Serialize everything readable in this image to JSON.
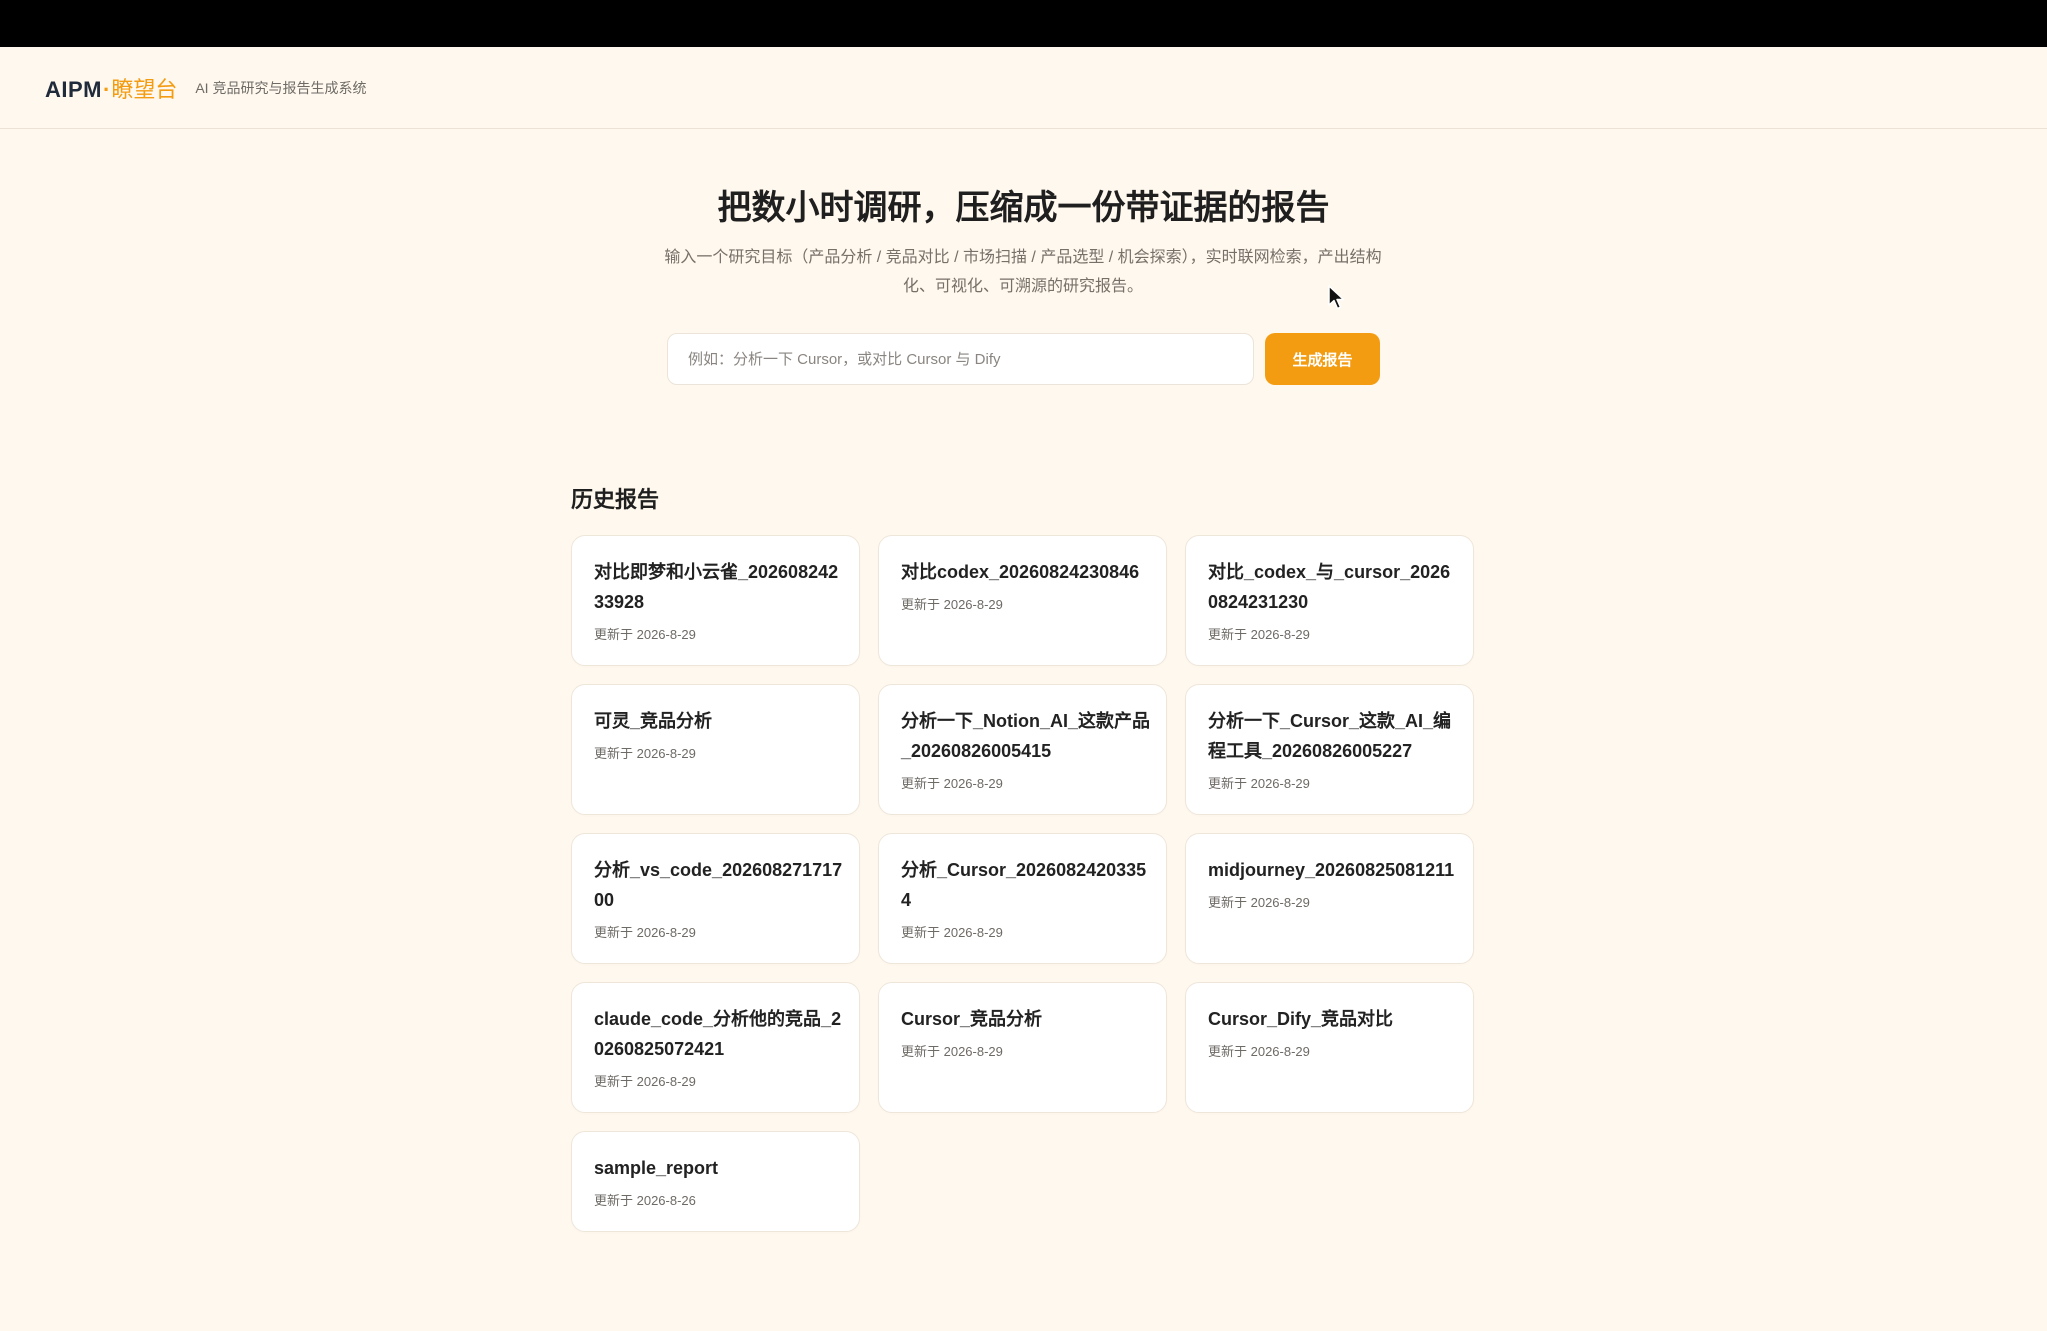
{
  "header": {
    "logo_main": "AIPM",
    "logo_dot": "·",
    "logo_cn": "瞭望台",
    "tagline": "AI 竞品研究与报告生成系统"
  },
  "hero": {
    "title": "把数小时调研，压缩成一份带证据的报告",
    "desc_line1": "输入一个研究目标（产品分析 / 竞品对比 / 市场扫描 / 产品选型 / 机会探索），实时联网检索，产出结构",
    "desc_line2": "化、可视化、可溯源的研究报告。"
  },
  "search": {
    "placeholder": "例如：分析一下 Cursor，或对比 Cursor 与 Dify",
    "value": "",
    "button_label": "生成报告"
  },
  "history": {
    "title": "历史报告",
    "reports": [
      {
        "title": "对比即梦和小云雀_20260824233928",
        "date": "更新于 2026-8-29"
      },
      {
        "title": "对比codex_20260824230846",
        "date": "更新于 2026-8-29"
      },
      {
        "title": "对比_codex_与_cursor_20260824231230",
        "date": "更新于 2026-8-29"
      },
      {
        "title": "可灵_竞品分析",
        "date": "更新于 2026-8-29"
      },
      {
        "title": "分析一下_Notion_AI_这款产品_20260826005415",
        "date": "更新于 2026-8-29"
      },
      {
        "title": "分析一下_Cursor_这款_AI_编程工具_20260826005227",
        "date": "更新于 2026-8-29"
      },
      {
        "title": "分析_vs_code_20260827171700",
        "date": "更新于 2026-8-29"
      },
      {
        "title": "分析_Cursor_20260824203354",
        "date": "更新于 2026-8-29"
      },
      {
        "title": "midjourney_20260825081211",
        "date": "更新于 2026-8-29"
      },
      {
        "title": "claude_code_分析他的竞品_20260825072421",
        "date": "更新于 2026-8-29"
      },
      {
        "title": "Cursor_竞品分析",
        "date": "更新于 2026-8-29"
      },
      {
        "title": "Cursor_Dify_竞品对比",
        "date": "更新于 2026-8-29"
      },
      {
        "title": "sample_report",
        "date": "更新于 2026-8-26"
      }
    ]
  },
  "colors": {
    "accent": "#f39c12",
    "background": "#fff8ee",
    "card": "#ffffff"
  }
}
